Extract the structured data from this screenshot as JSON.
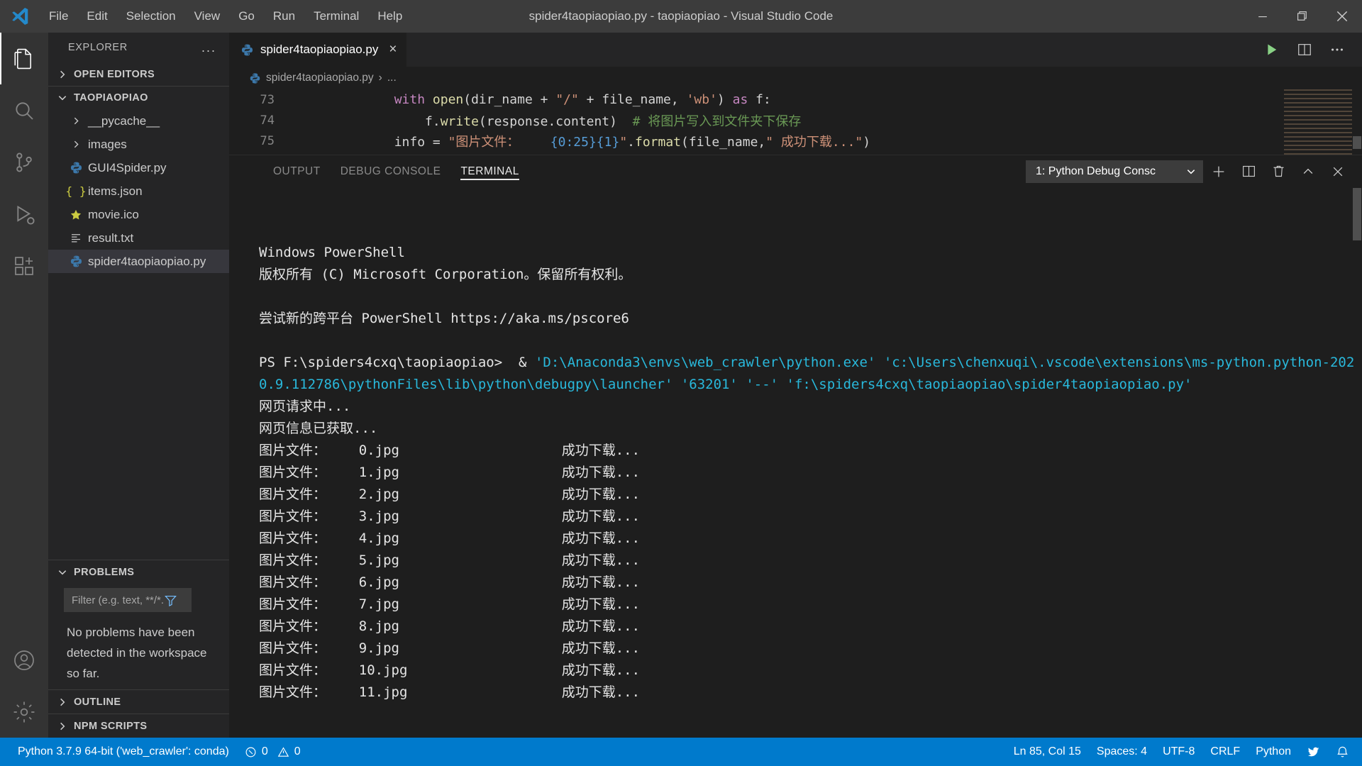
{
  "window": {
    "title": "spider4taopiaopiao.py - taopiaopiao - Visual Studio Code",
    "minimize_label": "Minimize",
    "maximize_label": "Restore",
    "close_label": "Close"
  },
  "menubar": {
    "logo": "vscode-logo-icon",
    "items": [
      {
        "label": "File"
      },
      {
        "label": "Edit"
      },
      {
        "label": "Selection"
      },
      {
        "label": "View"
      },
      {
        "label": "Go"
      },
      {
        "label": "Run"
      },
      {
        "label": "Terminal"
      },
      {
        "label": "Help"
      }
    ]
  },
  "activitybar": {
    "items": [
      {
        "name": "explorer",
        "icon": "files-icon",
        "active": true
      },
      {
        "name": "search",
        "icon": "search-icon",
        "active": false
      },
      {
        "name": "source-control",
        "icon": "source-control-icon",
        "active": false
      },
      {
        "name": "run-and-debug",
        "icon": "debug-icon",
        "active": false
      },
      {
        "name": "extensions",
        "icon": "extensions-icon",
        "active": false
      }
    ],
    "bottom": [
      {
        "name": "accounts",
        "icon": "account-icon"
      },
      {
        "name": "manage",
        "icon": "gear-icon"
      }
    ]
  },
  "sidebar": {
    "title": "EXPLORER",
    "more_actions": "...",
    "open_editors": {
      "label": "OPEN EDITORS",
      "expanded": false
    },
    "folder": {
      "label": "TAOPIAOPIAO",
      "expanded": true
    },
    "files": [
      {
        "label": "__pycache__",
        "icon": "folder-icon",
        "kind": "folder",
        "selected": false
      },
      {
        "label": "images",
        "icon": "folder-icon",
        "kind": "folder",
        "selected": false
      },
      {
        "label": "GUI4Spider.py",
        "icon": "python-icon",
        "kind": "file",
        "selected": false
      },
      {
        "label": "items.json",
        "icon": "json-icon",
        "kind": "file",
        "selected": false
      },
      {
        "label": "movie.ico",
        "icon": "star-icon",
        "kind": "file",
        "selected": false
      },
      {
        "label": "result.txt",
        "icon": "text-icon",
        "kind": "file",
        "selected": false
      },
      {
        "label": "spider4taopiaopiao.py",
        "icon": "python-icon",
        "kind": "file",
        "selected": true
      }
    ],
    "problems": {
      "label": "PROBLEMS",
      "expanded": true,
      "filter_placeholder": "Filter (e.g. text, **/*.ts, !**/node_modules/**)",
      "filter_value": "",
      "filter_icon": "filter-icon",
      "empty_message": "No problems have been detected in the workspace so far."
    },
    "outline": {
      "label": "OUTLINE",
      "expanded": false
    },
    "npm_scripts": {
      "label": "NPM SCRIPTS",
      "expanded": false
    }
  },
  "editor": {
    "tab": {
      "label": "spider4taopiaopiao.py",
      "icon": "python-icon",
      "close": "×"
    },
    "actions": [
      {
        "name": "run-python-file",
        "icon": "play-icon",
        "color": "#89d185"
      },
      {
        "name": "split-editor",
        "icon": "split-icon"
      },
      {
        "name": "more-actions",
        "icon": "ellipsis-icon"
      }
    ],
    "breadcrumb": {
      "file": "spider4taopiaopiao.py",
      "separator": "›",
      "tail": "..."
    },
    "lines": [
      {
        "number": "73",
        "tokens": [
          {
            "t": "        ",
            "c": "plain"
          },
          {
            "t": "with ",
            "c": "keyword"
          },
          {
            "t": "open",
            "c": "function"
          },
          {
            "t": "(dir_name ",
            "c": "plain"
          },
          {
            "t": "+",
            "c": "op"
          },
          {
            "t": " ",
            "c": "plain"
          },
          {
            "t": "\"/\"",
            "c": "string"
          },
          {
            "t": " ",
            "c": "plain"
          },
          {
            "t": "+",
            "c": "op"
          },
          {
            "t": " file_name, ",
            "c": "plain"
          },
          {
            "t": "'wb'",
            "c": "string"
          },
          {
            "t": ") ",
            "c": "plain"
          },
          {
            "t": "as",
            "c": "keyword"
          },
          {
            "t": " f:",
            "c": "plain"
          }
        ]
      },
      {
        "number": "74",
        "tokens": [
          {
            "t": "            f.",
            "c": "plain"
          },
          {
            "t": "write",
            "c": "function"
          },
          {
            "t": "(response.content)  ",
            "c": "plain"
          },
          {
            "t": "# 将图片写入到文件夹下保存",
            "c": "comment"
          }
        ]
      },
      {
        "number": "75",
        "tokens": [
          {
            "t": "        info ",
            "c": "plain"
          },
          {
            "t": "=",
            "c": "op"
          },
          {
            "t": " ",
            "c": "plain"
          },
          {
            "t": "\"图片文件：    ",
            "c": "string"
          },
          {
            "t": "{0:25}{1}",
            "c": "brace"
          },
          {
            "t": "\"",
            "c": "string"
          },
          {
            "t": ".",
            "c": "plain"
          },
          {
            "t": "format",
            "c": "function"
          },
          {
            "t": "(file_name,",
            "c": "plain"
          },
          {
            "t": "\" 成功下载...\"",
            "c": "string"
          },
          {
            "t": ")",
            "c": "plain"
          }
        ]
      }
    ]
  },
  "panel": {
    "tabs": [
      {
        "label": "OUTPUT",
        "active": false
      },
      {
        "label": "DEBUG CONSOLE",
        "active": false
      },
      {
        "label": "TERMINAL",
        "active": true
      }
    ],
    "terminal_selector": {
      "value": "1: Python Debug Consc",
      "chevron": "chevron-down-icon"
    },
    "actions": [
      {
        "name": "new-terminal",
        "icon": "plus-icon"
      },
      {
        "name": "split-terminal",
        "icon": "split-icon"
      },
      {
        "name": "kill-terminal",
        "icon": "trash-icon"
      },
      {
        "name": "maximize-panel",
        "icon": "chevron-up-icon"
      },
      {
        "name": "close-panel",
        "icon": "close-icon"
      }
    ],
    "terminal_output": [
      {
        "text": "Windows PowerShell",
        "color": "white"
      },
      {
        "text": "版权所有 (C) Microsoft Corporation。保留所有权利。",
        "color": "white"
      },
      {
        "text": "",
        "color": "white"
      },
      {
        "text": "尝试新的跨平台 PowerShell https://aka.ms/pscore6",
        "color": "white"
      },
      {
        "text": "",
        "color": "white"
      },
      {
        "text": "PS F:\\spiders4cxq\\taopiaopiao>  & ",
        "color": "white",
        "suffix": "'D:\\Anaconda3\\envs\\web_crawler\\python.exe' 'c:\\Users\\chenxuqi\\.vscode\\extensions\\ms-python.python-2020.9.112786\\pythonFiles\\lib\\python\\debugpy\\launcher' '63201' '--' 'f:\\spiders4cxq\\taopiaopiao\\spider4taopiaopiao.py'",
        "suffix_color": "cyan"
      },
      {
        "text": "网页请求中...",
        "color": "white"
      },
      {
        "text": "网页信息已获取...",
        "color": "white"
      },
      {
        "text": "图片文件：    0.jpg                    成功下载...",
        "color": "white"
      },
      {
        "text": "图片文件：    1.jpg                    成功下载...",
        "color": "white"
      },
      {
        "text": "图片文件：    2.jpg                    成功下载...",
        "color": "white"
      },
      {
        "text": "图片文件：    3.jpg                    成功下载...",
        "color": "white"
      },
      {
        "text": "图片文件：    4.jpg                    成功下载...",
        "color": "white"
      },
      {
        "text": "图片文件：    5.jpg                    成功下载...",
        "color": "white"
      },
      {
        "text": "图片文件：    6.jpg                    成功下载...",
        "color": "white"
      },
      {
        "text": "图片文件：    7.jpg                    成功下载...",
        "color": "white"
      },
      {
        "text": "图片文件：    8.jpg                    成功下载...",
        "color": "white"
      },
      {
        "text": "图片文件：    9.jpg                    成功下载...",
        "color": "white"
      },
      {
        "text": "图片文件：    10.jpg                   成功下载...",
        "color": "white"
      },
      {
        "text": "图片文件：    11.jpg                   成功下载...",
        "color": "white"
      }
    ]
  },
  "statusbar": {
    "background": "#007acc",
    "left": [
      {
        "name": "python-interpreter",
        "label": "Python 3.7.9 64-bit ('web_crawler': conda)"
      },
      {
        "name": "errors-warnings",
        "label": "0",
        "label2": "0",
        "error_icon": "error-circle-icon",
        "warning_icon": "warning-triangle-icon"
      }
    ],
    "right": [
      {
        "name": "cursor-position",
        "label": "Ln 85, Col 15"
      },
      {
        "name": "indentation",
        "label": "Spaces: 4"
      },
      {
        "name": "encoding",
        "label": "UTF-8"
      },
      {
        "name": "eol",
        "label": "CRLF"
      },
      {
        "name": "language-mode",
        "label": "Python"
      },
      {
        "name": "tweet-feedback",
        "label": "",
        "icon": "feedback-icon"
      },
      {
        "name": "notifications",
        "label": "",
        "icon": "bell-icon"
      }
    ]
  }
}
